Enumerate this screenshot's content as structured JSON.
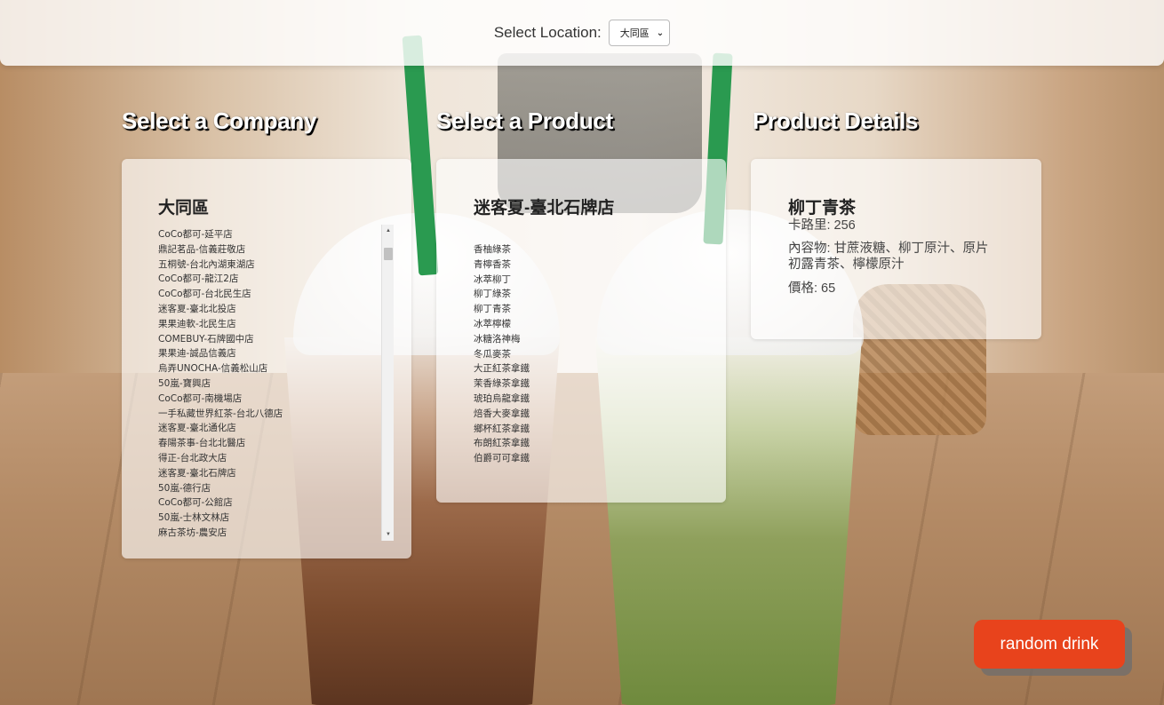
{
  "topbar": {
    "label": "Select Location:",
    "location_value": "大同區"
  },
  "columns": {
    "company_heading": "Select a Company",
    "product_heading": "Select a Product",
    "details_heading": "Product Details"
  },
  "company_card": {
    "title": "大同區",
    "stores": [
      "CoCo都可-延平店",
      "鼎記茗品-信義莊敬店",
      "五桐號-台北內湖東湖店",
      "CoCo都可-龍江2店",
      "CoCo都可-台北民生店",
      "迷客夏-臺北北投店",
      "果果迪軟-北民生店",
      "COMEBUY-石牌國中店",
      "果果迪-誠品信義店",
      "烏弄UNOCHA-信義松山店",
      "50嵐-寶興店",
      "CoCo都可-南機場店",
      "一手私藏世界紅茶-台北八德店",
      "迷客夏-臺北通化店",
      "春陽茶事-台北北醫店",
      "得正-台北政大店",
      "迷客夏-臺北石牌店",
      "50嵐-德行店",
      "CoCo都可-公館店",
      "50嵐-士林文林店",
      "麻古茶坊-農安店"
    ]
  },
  "product_card": {
    "title": "迷客夏-臺北石牌店",
    "products": [
      "香柚綠茶",
      "青檸香茶",
      "冰萃柳丁",
      "柳丁綠茶",
      "柳丁青茶",
      "冰萃檸檬",
      "冰糖洛神梅",
      "冬瓜麥茶",
      "大正紅茶拿鐵",
      "茉香綠茶拿鐵",
      "琥珀烏龍拿鐵",
      "焙香大麥拿鐵",
      "鄉杯紅茶拿鐵",
      "布朗紅茶拿鐵",
      "伯爵可可拿鐵"
    ]
  },
  "details_card": {
    "name": "柳丁青茶",
    "calories": "卡路里: 256",
    "contents_line1": "內容物: 甘蔗液糖、柳丁原汁、原片",
    "contents_line2": "初露青茶、檸檬原汁",
    "price": "價格: 65"
  },
  "random_button": "random drink"
}
